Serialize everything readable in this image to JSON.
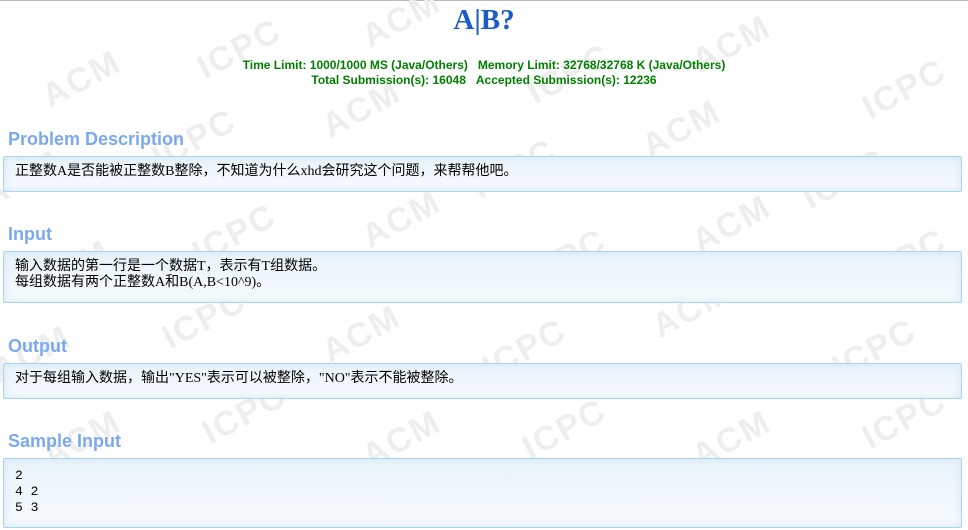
{
  "problem": {
    "title": "A|B?"
  },
  "limits": {
    "time_limit": "Time Limit: 1000/1000 MS (Java/Others)",
    "memory_limit": "Memory Limit: 32768/32768 K (Java/Others)",
    "total_submissions": "Total Submission(s): 16048",
    "accepted_submissions": "Accepted Submission(s): 12236"
  },
  "watermark": "ACM ICPC",
  "sections": {
    "description": {
      "heading": "Problem Description",
      "lines": [
        "正整数A是否能被正整数B整除，不知道为什么xhd会研究这个问题，来帮帮他吧。"
      ]
    },
    "input": {
      "heading": "Input",
      "lines": [
        "输入数据的第一行是一个数据T，表示有T组数据。",
        "每组数据有两个正整数A和B(A,B<10^9)。"
      ]
    },
    "output": {
      "heading": "Output",
      "lines": [
        "对于每组输入数据，输出\"YES\"表示可以被整除，\"NO\"表示不能被整除。"
      ]
    },
    "sample_input": {
      "heading": "Sample Input",
      "lines": [
        "2",
        "4 2",
        "5 3"
      ]
    }
  },
  "colors": {
    "title": "#1a5cc8",
    "limits": "#008000",
    "section_heading": "#7ca9ed",
    "panel_border": "#a9d5ef"
  }
}
